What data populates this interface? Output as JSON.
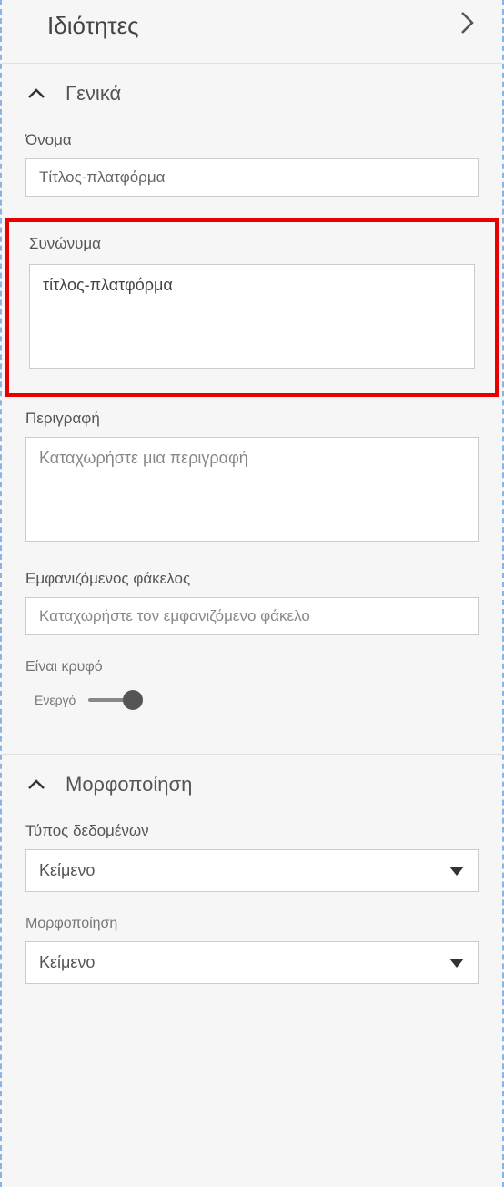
{
  "panel": {
    "title": "Ιδιότητες"
  },
  "sections": {
    "general": {
      "title": "Γενικά",
      "fields": {
        "name": {
          "label": "Όνομα",
          "value": "Τίτλος-πλατφόρμα"
        },
        "synonyms": {
          "label": "Συνώνυμα",
          "value": "τίτλος-πλατφόρμα"
        },
        "description": {
          "label": "Περιγραφή",
          "placeholder": "Καταχωρήστε μια περιγραφή"
        },
        "displayFolder": {
          "label": "Εμφανιζόμενος φάκελος",
          "placeholder": "Καταχωρήστε τον εμφανιζόμενο φάκελο"
        },
        "isHidden": {
          "label": "Είναι κρυφό",
          "toggleLabel": "Ενεργό"
        }
      }
    },
    "formatting": {
      "title": "Μορφοποίηση",
      "fields": {
        "dataType": {
          "label": "Τύπος δεδομένων",
          "value": "Κείμενο"
        },
        "format": {
          "label": "Μορφοποίηση",
          "value": "Κείμενο"
        }
      }
    }
  }
}
